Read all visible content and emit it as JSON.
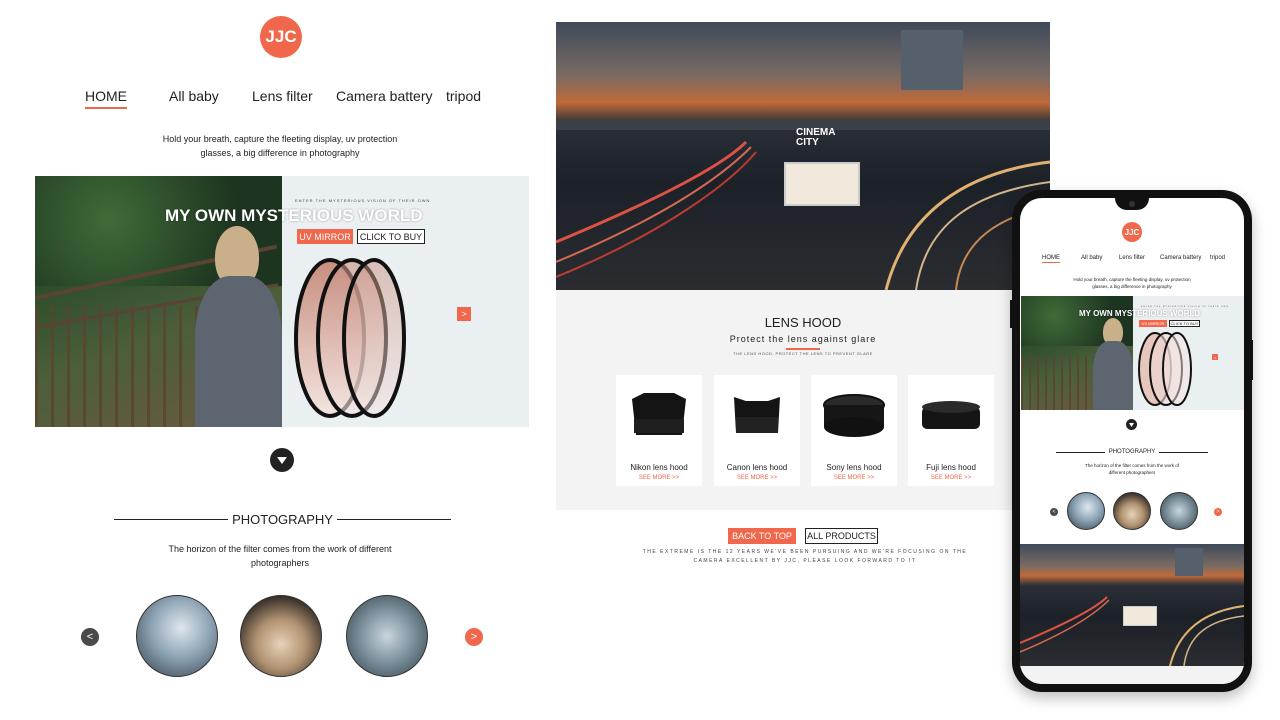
{
  "brand": {
    "logo": "JJC",
    "accent": "#f0674b"
  },
  "nav": {
    "items": [
      "HOME",
      "All baby",
      "Lens filter",
      "Camera battery",
      "tripod"
    ]
  },
  "tagline": "Hold your breath, capture the fleeting display, uv protection glasses, a big difference in photography",
  "banner": {
    "kicker": "ENTER THE MYSTERIOUS VISION OF THEIR OWN",
    "title": "MY OWN MYSTERIOUS WORLD",
    "uv_label": "UV MIRROR",
    "buy_label": "CLICK TO BUY",
    "next_glyph": ">"
  },
  "photography": {
    "title": "PHOTOGRAPHY",
    "subtitle": "The horizon of the filter comes from the work of different photographers",
    "prev_glyph": "<",
    "next_glyph": ">"
  },
  "hero_sign": {
    "line1": "CINEMA",
    "line2": "CITY"
  },
  "lens_hood": {
    "title": "LENS HOOD",
    "subtitle": "Protect the lens against glare",
    "mini": "THE LENS HOOD, PROTECT THE LENS TO PREVENT GLARE",
    "cards": [
      {
        "name": "Nikon lens hood",
        "more": "SEE MORE >>"
      },
      {
        "name": "Canon lens hood",
        "more": "SEE MORE >>"
      },
      {
        "name": "Sony lens hood",
        "more": "SEE MORE >>"
      },
      {
        "name": "Fuji lens hood",
        "more": "SEE MORE >>"
      }
    ]
  },
  "footer": {
    "back_to_top": "BACK TO TOP",
    "all_products": "ALL PRODUCTS",
    "text": "THE EXTREME IS THE 12 YEARS WE'VE BEEN PURSUING AND WE'RE FOCUSING ON THE CAMERA EXCELLENT BY JJC, PLEASE LOOK FORWARD TO IT"
  },
  "icons": {
    "down": "chevron-down-icon",
    "next": "chevron-right-icon",
    "prev": "chevron-left-icon"
  }
}
